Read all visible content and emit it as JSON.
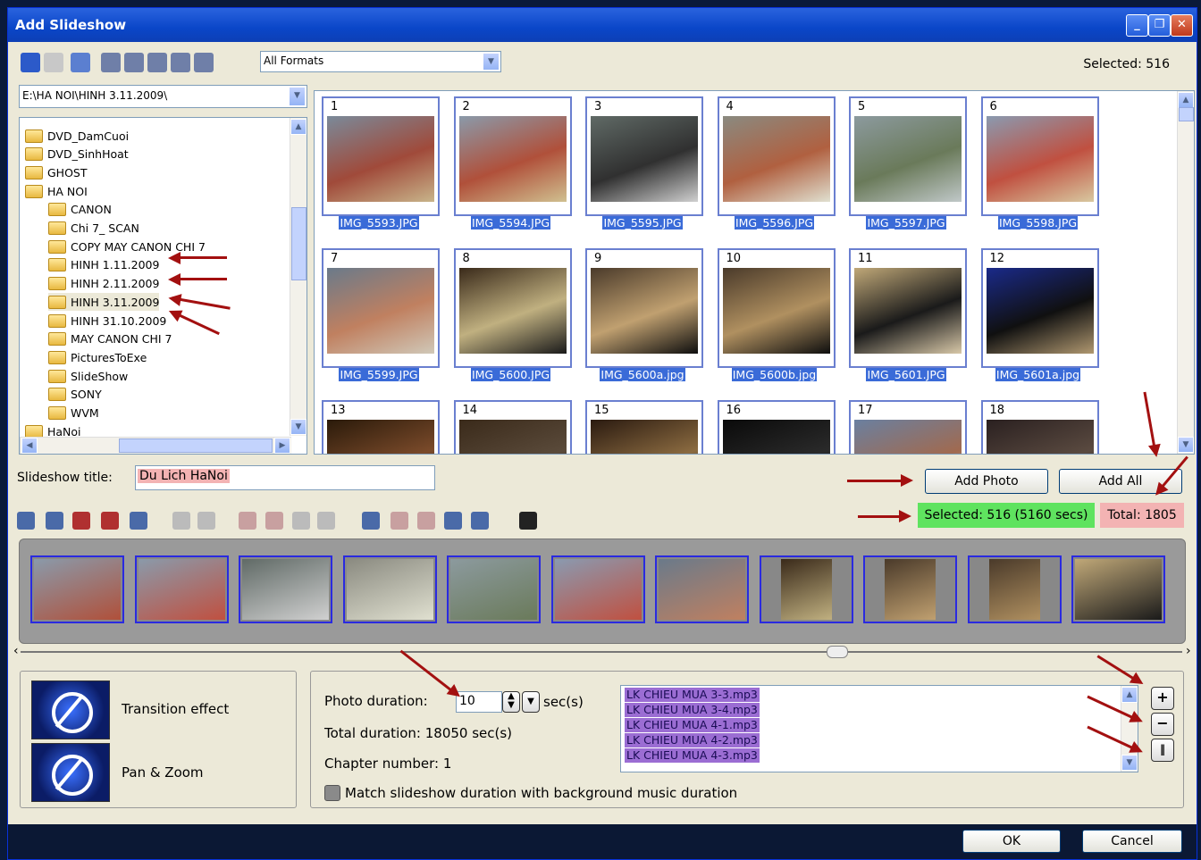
{
  "window": {
    "title": "Add Slideshow"
  },
  "toolbar": {
    "format_value": "All Formats",
    "selected_label": "Selected: 516"
  },
  "path": {
    "value": "E:\\HA NOI\\HINH 3.11.2009\\"
  },
  "tree": {
    "items": [
      {
        "label": "DVD_DamCuoi",
        "indent": 0
      },
      {
        "label": "DVD_SinhHoat",
        "indent": 0
      },
      {
        "label": "GHOST",
        "indent": 0
      },
      {
        "label": "HA NOI",
        "indent": 0
      },
      {
        "label": "CANON",
        "indent": 1
      },
      {
        "label": "Chi 7_ SCAN",
        "indent": 1
      },
      {
        "label": "COPY MAY CANON CHI 7",
        "indent": 1
      },
      {
        "label": "HINH 1.11.2009",
        "indent": 1
      },
      {
        "label": "HINH 2.11.2009",
        "indent": 1
      },
      {
        "label": "HINH 3.11.2009",
        "indent": 1,
        "selected": true
      },
      {
        "label": "HINH 31.10.2009",
        "indent": 1
      },
      {
        "label": "MAY CANON CHI 7",
        "indent": 1
      },
      {
        "label": "PicturesToExe",
        "indent": 1
      },
      {
        "label": "SlideShow",
        "indent": 1
      },
      {
        "label": "SONY",
        "indent": 1
      },
      {
        "label": "WVM",
        "indent": 1
      },
      {
        "label": "HaNoi",
        "indent": 0
      }
    ]
  },
  "gallery": {
    "thumbs": [
      {
        "num": "1",
        "name": "IMG_5593.JPG"
      },
      {
        "num": "2",
        "name": "IMG_5594.JPG"
      },
      {
        "num": "3",
        "name": "IMG_5595.JPG"
      },
      {
        "num": "4",
        "name": "IMG_5596.JPG"
      },
      {
        "num": "5",
        "name": "IMG_5597.JPG"
      },
      {
        "num": "6",
        "name": "IMG_5598.JPG"
      },
      {
        "num": "7",
        "name": "IMG_5599.JPG"
      },
      {
        "num": "8",
        "name": "IMG_5600.JPG"
      },
      {
        "num": "9",
        "name": "IMG_5600a.jpg"
      },
      {
        "num": "10",
        "name": "IMG_5600b.jpg"
      },
      {
        "num": "11",
        "name": "IMG_5601.JPG"
      },
      {
        "num": "12",
        "name": "IMG_5601a.jpg"
      },
      {
        "num": "13",
        "name": ""
      },
      {
        "num": "14",
        "name": ""
      },
      {
        "num": "15",
        "name": ""
      },
      {
        "num": "16",
        "name": ""
      },
      {
        "num": "17",
        "name": ""
      },
      {
        "num": "18",
        "name": ""
      }
    ]
  },
  "slideshow": {
    "title_label": "Slideshow title:",
    "title_value": "Du Lich HaNoi",
    "add_photo": "Add Photo",
    "add_all": "Add All",
    "selected": "Selected: 516 (5160 secs)",
    "total": "Total: 1805"
  },
  "effects": {
    "transition": "Transition effect",
    "pan_zoom": "Pan & Zoom"
  },
  "settings": {
    "duration_label": "Photo duration:",
    "duration_value": "10",
    "duration_unit": "sec(s)",
    "total_duration": "Total duration: 18050 sec(s)",
    "chapter": "Chapter number: 1",
    "match_label": "Match slideshow duration with background music duration"
  },
  "music": {
    "tracks": [
      "LK CHIEU MUA 3-3.mp3",
      "LK CHIEU MUA 3-4.mp3",
      "LK CHIEU MUA 4-1.mp3",
      "LK CHIEU MUA 4-2.mp3",
      "LK CHIEU MUA 4-3.mp3"
    ]
  },
  "dialog": {
    "ok": "OK",
    "cancel": "Cancel"
  },
  "colors": {
    "selected_bg": "#5fe35f",
    "total_bg": "#f3b3b3",
    "title_bg": "#f3b3b3",
    "accent": "#a31010"
  }
}
